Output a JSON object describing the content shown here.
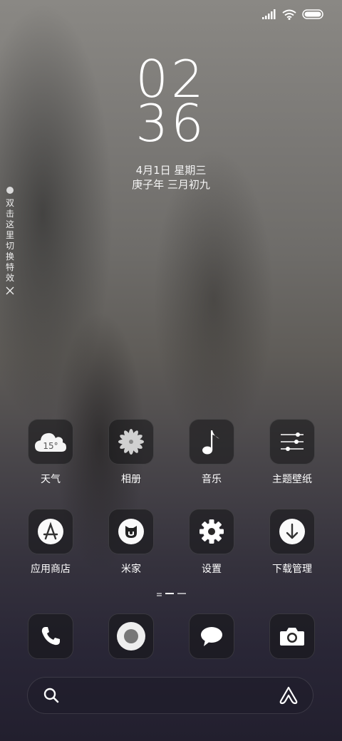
{
  "status_bar": {
    "icons": [
      "signal-icon",
      "wifi-icon",
      "battery-icon"
    ]
  },
  "clock": {
    "hour": "02",
    "minute": "36"
  },
  "date": {
    "gregorian": "4月1日 星期三",
    "lunar": "庚子年 三月初九"
  },
  "side_tab": {
    "text": "双击这里切换特效"
  },
  "apps_row1": [
    {
      "label": "天气",
      "icon": "weather-cloud-icon",
      "temp": "15°"
    },
    {
      "label": "相册",
      "icon": "gallery-flower-icon"
    },
    {
      "label": "音乐",
      "icon": "music-note-icon"
    },
    {
      "label": "主题壁纸",
      "icon": "theme-sliders-icon"
    }
  ],
  "apps_row2": [
    {
      "label": "应用商店",
      "icon": "app-store-icon"
    },
    {
      "label": "米家",
      "icon": "mijia-icon"
    },
    {
      "label": "设置",
      "icon": "settings-gear-icon"
    },
    {
      "label": "下载管理",
      "icon": "download-arrow-icon"
    }
  ],
  "pager": {
    "pages": 3,
    "current": 2
  },
  "dock": [
    {
      "icon": "phone-icon"
    },
    {
      "icon": "browser-circle-icon"
    },
    {
      "icon": "message-bubble-icon"
    },
    {
      "icon": "camera-icon"
    }
  ],
  "search_bar": {
    "left_icon": "search-icon",
    "right_icon": "assistant-logo-icon"
  }
}
